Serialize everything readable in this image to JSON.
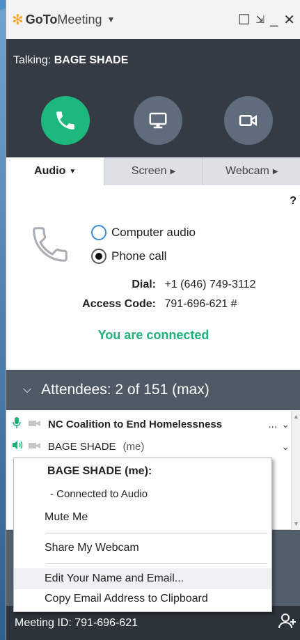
{
  "titlebar": {
    "logo_goto": "GoTo",
    "logo_meeting": "Meeting",
    "icons": [
      "orange-flower-logo-icon",
      "caret-down-icon",
      "maximize-icon",
      "shrink-icon",
      "minimize-icon",
      "close-icon"
    ]
  },
  "talking": {
    "label": "Talking:",
    "name": "BAGE SHADE"
  },
  "call_buttons": [
    "phone-icon",
    "screen-share-icon",
    "webcam-icon"
  ],
  "tabs": [
    {
      "label": "Audio",
      "active": true
    },
    {
      "label": "Screen",
      "active": false
    },
    {
      "label": "Webcam",
      "active": false
    }
  ],
  "audio": {
    "help": "?",
    "options": [
      {
        "label": "Computer audio",
        "selected": false
      },
      {
        "label": "Phone call",
        "selected": true
      }
    ],
    "dial_label": "Dial:",
    "dial_value": "+1 (646) 749-3112",
    "access_label": "Access Code:",
    "access_value": "791-696-621 #",
    "status": "You are connected",
    "status_color": "#1fb177"
  },
  "attendees": {
    "header": "Attendees: 2 of 151 (max)",
    "rows": [
      {
        "name": "NC Coalition to End Homelessness",
        "me": "",
        "icons": [
          "microphone-icon",
          "camera-off-icon"
        ]
      },
      {
        "name": "BAGE SHADE",
        "me": "(me)",
        "icons": [
          "speaker-icon",
          "camera-off-icon"
        ]
      }
    ],
    "ellipsis": "..."
  },
  "context_menu": {
    "title": "BAGE SHADE (me):",
    "status": "- Connected to Audio",
    "items": [
      "Mute Me",
      "Share My Webcam",
      "Edit Your Name and Email...",
      "Copy Email Address to Clipboard"
    ]
  },
  "footer": {
    "meeting_id": "Meeting ID: 791-696-621"
  },
  "colors": {
    "accent_green": "#1db87e",
    "dark_bar": "#343b45",
    "attendee_header": "#4f5a66"
  }
}
